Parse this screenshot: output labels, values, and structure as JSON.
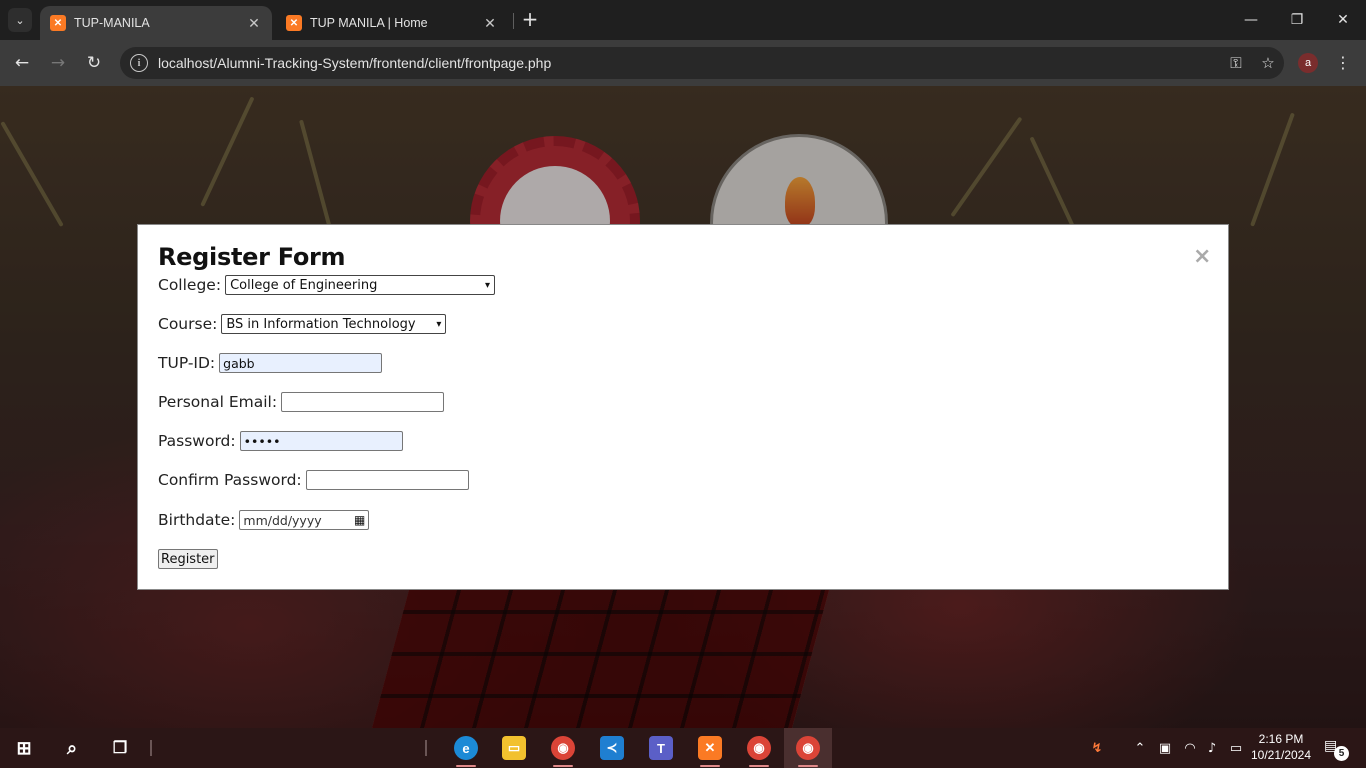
{
  "browser": {
    "tabs": [
      {
        "title": "TUP-MANILA",
        "active": true
      },
      {
        "title": "TUP MANILA | Home",
        "active": false
      }
    ],
    "url": "localhost/Alumni-Tracking-System/frontend/client/frontpage.php",
    "profile_initial": "a"
  },
  "modal": {
    "title": "Register Form",
    "close_symbol": "×",
    "fields": {
      "college": {
        "label": "College:",
        "value": "College of Engineering"
      },
      "course": {
        "label": "Course:",
        "value": "BS in Information Technology"
      },
      "tup_id": {
        "label": "TUP-ID:",
        "value": "gabb"
      },
      "email": {
        "label": "Personal Email:",
        "value": ""
      },
      "password": {
        "label": "Password:",
        "value": "•••••"
      },
      "confirm_password": {
        "label": "Confirm Password:",
        "value": ""
      },
      "birthdate": {
        "label": "Birthdate:",
        "placeholder": "mm/dd/yyyy"
      }
    },
    "submit_label": "Register"
  },
  "taskbar": {
    "apps": [
      "start-icon",
      "search-icon",
      "task-view-icon",
      "edge-icon",
      "file-explorer-icon",
      "chrome-icon",
      "vscode-icon",
      "teams-icon",
      "xampp-icon",
      "chrome-profile-s-icon",
      "chrome-profile-a-icon"
    ],
    "time": "2:16 PM",
    "date": "10/21/2024",
    "notification_count": "5"
  },
  "colors": {
    "accent": "#fb7a24",
    "chrome_dark": "#1f1f1f",
    "toolbar": "#3c3c3c",
    "modal_bg": "#ffffff"
  }
}
